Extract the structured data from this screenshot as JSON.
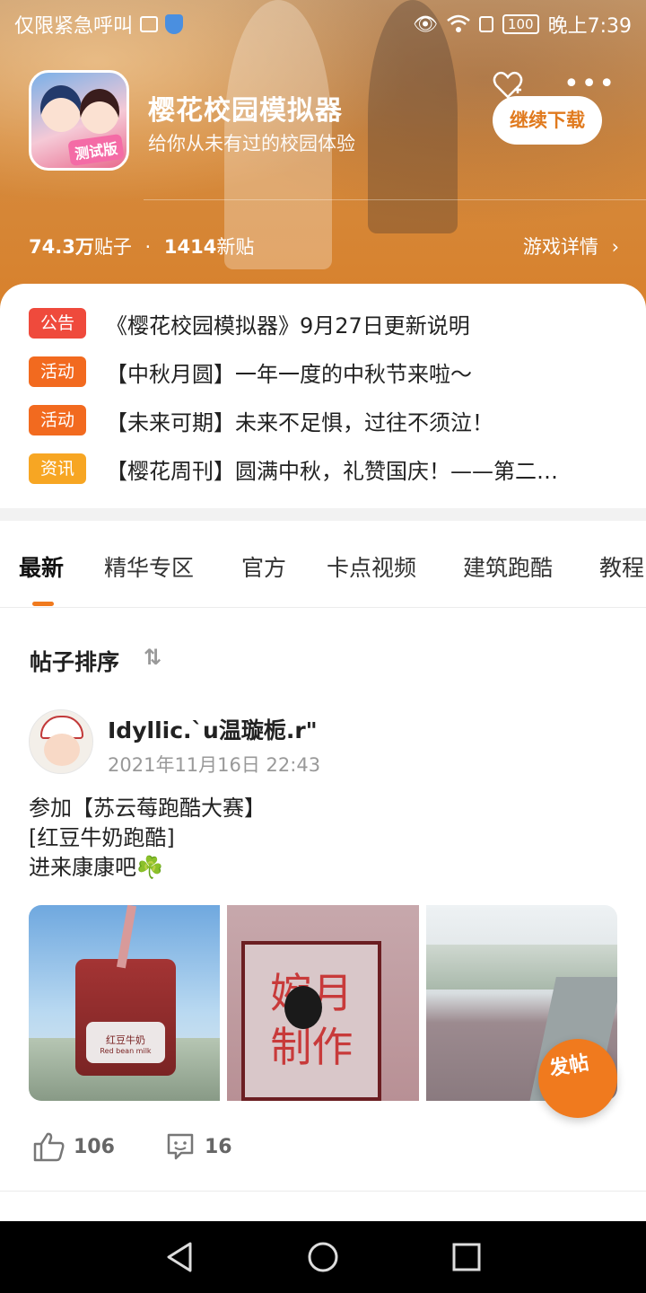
{
  "status_bar": {
    "left_text": "仅限紧急呼叫",
    "battery": "100",
    "time": "晚上7:39"
  },
  "header": {
    "game_title": "樱花校园模拟器",
    "subtitle": "给你从未有过的校园体验",
    "icon_badge": "测试版",
    "continue_button": "继续下载",
    "more_label": "•••",
    "posts_count": "74.3万",
    "posts_label": "贴子",
    "dot": "·",
    "new_posts_count": "1414",
    "new_posts_label": "新贴",
    "details_link": "游戏详情"
  },
  "notices": [
    {
      "tag": "公告",
      "color": "#ef4a3c",
      "text": "《樱花校园模拟器》9月27日更新说明"
    },
    {
      "tag": "活动",
      "color": "#f26a1f",
      "text": "【中秋月圆】一年一度的中秋节来啦～"
    },
    {
      "tag": "活动",
      "color": "#f26a1f",
      "text": "【未来可期】未来不足惧，过往不须泣！"
    },
    {
      "tag": "资讯",
      "color": "#f7a623",
      "text": "【樱花周刊】圆满中秋，礼赞国庆！——第二…"
    }
  ],
  "tabs": [
    "最新",
    "精华专区",
    "官方",
    "卡点视频",
    "建筑跑酷",
    "教程"
  ],
  "sort": {
    "label": "帖子排序",
    "icon": "⇅"
  },
  "post": {
    "user": "Idyllic.`u温璇栀.r\"",
    "time": "2021年11月16日 22:43",
    "line1": "参加【苏云莓跑酷大赛】",
    "line2": "[红豆牛奶跑酷]",
    "line3": "进来康康吧☘️",
    "image1_label": "红豆牛奶",
    "image1_sub": "Red bean milk",
    "image2_text": "婉月\n制作",
    "likes": "106",
    "comments": "16"
  },
  "fab_label": "发帖",
  "colors": {
    "accent": "#f07a1e",
    "hero": "#d8812c"
  }
}
